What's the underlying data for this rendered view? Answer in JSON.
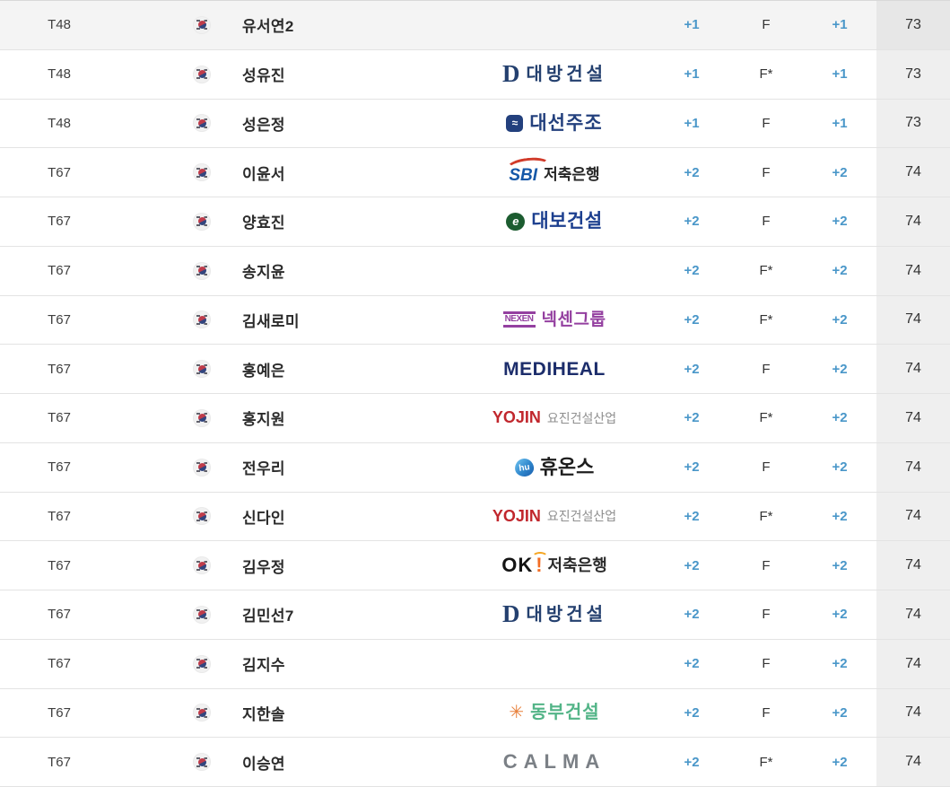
{
  "colors": {
    "score_blue": "#4a97c9",
    "row_highlight_bg": "#f4f4f4",
    "total_column_bg": "#efefef",
    "divider": "#e3e3e3",
    "text_dark": "#333333"
  },
  "table": {
    "columns": [
      "rank",
      "country-flag",
      "player",
      "sponsor",
      "round-score",
      "thru",
      "total-to-par",
      "total-strokes"
    ],
    "rows": [
      {
        "rank": "T48",
        "country": "KR",
        "player": "유서연2",
        "sponsor": null,
        "round": "+1",
        "thru": "F",
        "today": "+1",
        "total": "73",
        "highlighted": true
      },
      {
        "rank": "T48",
        "country": "KR",
        "player": "성유진",
        "sponsor": {
          "style": "daebang",
          "mark": "D",
          "label": "대방건설"
        },
        "round": "+1",
        "thru": "F*",
        "today": "+1",
        "total": "73"
      },
      {
        "rank": "T48",
        "country": "KR",
        "player": "성은정",
        "sponsor": {
          "style": "daesun",
          "mark": "≈",
          "label": "대선주조"
        },
        "round": "+1",
        "thru": "F",
        "today": "+1",
        "total": "73"
      },
      {
        "rank": "T67",
        "country": "KR",
        "player": "이윤서",
        "sponsor": {
          "style": "sbi",
          "mark": "SBI",
          "label": "저축은행"
        },
        "round": "+2",
        "thru": "F",
        "today": "+2",
        "total": "74"
      },
      {
        "rank": "T67",
        "country": "KR",
        "player": "양효진",
        "sponsor": {
          "style": "daebo",
          "mark": "e",
          "label": "대보건설"
        },
        "round": "+2",
        "thru": "F",
        "today": "+2",
        "total": "74"
      },
      {
        "rank": "T67",
        "country": "KR",
        "player": "송지윤",
        "sponsor": null,
        "round": "+2",
        "thru": "F*",
        "today": "+2",
        "total": "74"
      },
      {
        "rank": "T67",
        "country": "KR",
        "player": "김새로미",
        "sponsor": {
          "style": "nexen",
          "mark": "NEXEN",
          "label": "넥센그룹"
        },
        "round": "+2",
        "thru": "F*",
        "today": "+2",
        "total": "74"
      },
      {
        "rank": "T67",
        "country": "KR",
        "player": "홍예은",
        "sponsor": {
          "style": "mediheal",
          "label": "MEDIHEAL"
        },
        "round": "+2",
        "thru": "F",
        "today": "+2",
        "total": "74"
      },
      {
        "rank": "T67",
        "country": "KR",
        "player": "홍지원",
        "sponsor": {
          "style": "yojin",
          "mark": "YOJIN",
          "label": "요진건설산업"
        },
        "round": "+2",
        "thru": "F*",
        "today": "+2",
        "total": "74"
      },
      {
        "rank": "T67",
        "country": "KR",
        "player": "전우리",
        "sponsor": {
          "style": "huons",
          "mark": "hu",
          "label": "휴온스"
        },
        "round": "+2",
        "thru": "F",
        "today": "+2",
        "total": "74"
      },
      {
        "rank": "T67",
        "country": "KR",
        "player": "신다인",
        "sponsor": {
          "style": "yojin",
          "mark": "YOJIN",
          "label": "요진건설산업"
        },
        "round": "+2",
        "thru": "F*",
        "today": "+2",
        "total": "74"
      },
      {
        "rank": "T67",
        "country": "KR",
        "player": "김우정",
        "sponsor": {
          "style": "ok",
          "mark": "OK",
          "bang": "!",
          "label": "저축은행"
        },
        "round": "+2",
        "thru": "F",
        "today": "+2",
        "total": "74"
      },
      {
        "rank": "T67",
        "country": "KR",
        "player": "김민선7",
        "sponsor": {
          "style": "daebang",
          "mark": "D",
          "label": "대방건설"
        },
        "round": "+2",
        "thru": "F",
        "today": "+2",
        "total": "74"
      },
      {
        "rank": "T67",
        "country": "KR",
        "player": "김지수",
        "sponsor": null,
        "round": "+2",
        "thru": "F",
        "today": "+2",
        "total": "74"
      },
      {
        "rank": "T67",
        "country": "KR",
        "player": "지한솔",
        "sponsor": {
          "style": "dongbu",
          "mark": "✳",
          "label": "동부건설"
        },
        "round": "+2",
        "thru": "F",
        "today": "+2",
        "total": "74"
      },
      {
        "rank": "T67",
        "country": "KR",
        "player": "이승연",
        "sponsor": {
          "style": "calma",
          "label": "CALMA"
        },
        "round": "+2",
        "thru": "F*",
        "today": "+2",
        "total": "74"
      }
    ]
  }
}
